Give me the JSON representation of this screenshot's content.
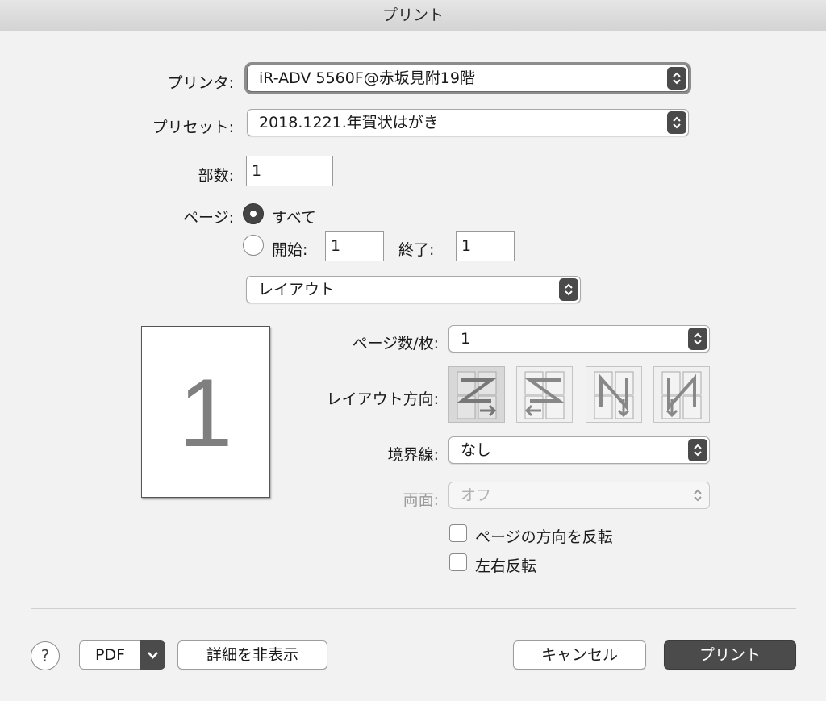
{
  "window": {
    "title": "プリント"
  },
  "printer": {
    "label": "プリンタ:",
    "value": "iR-ADV 5560F@赤坂見附19階"
  },
  "preset": {
    "label": "プリセット:",
    "value": "2018.1221.年賀状はがき"
  },
  "copies": {
    "label": "部数:",
    "value": "1"
  },
  "pages": {
    "label": "ページ:",
    "all_label": "すべて",
    "all_selected": true,
    "from_label": "開始:",
    "from_value": "1",
    "to_label": "終了:",
    "to_value": "1"
  },
  "section": {
    "value": "レイアウト"
  },
  "preview": {
    "page_number": "1"
  },
  "layout": {
    "pages_per_sheet_label": "ページ数/枚:",
    "pages_per_sheet_value": "1",
    "direction_label": "レイアウト方向:",
    "direction_options": [
      "z-left-right",
      "z-right-left",
      "n-top-down",
      "n-reverse"
    ],
    "direction_selected": 0,
    "border_label": "境界線:",
    "border_value": "なし",
    "two_sided_label": "両面:",
    "two_sided_value": "オフ",
    "reverse_orientation_label": "ページの方向を反転",
    "reverse_orientation_checked": false,
    "flip_horizontal_label": "左右反転",
    "flip_horizontal_checked": false
  },
  "footer": {
    "help_label": "?",
    "pdf_label": "PDF",
    "hide_details_label": "詳細を非表示",
    "cancel_label": "キャンセル",
    "print_label": "プリント"
  }
}
